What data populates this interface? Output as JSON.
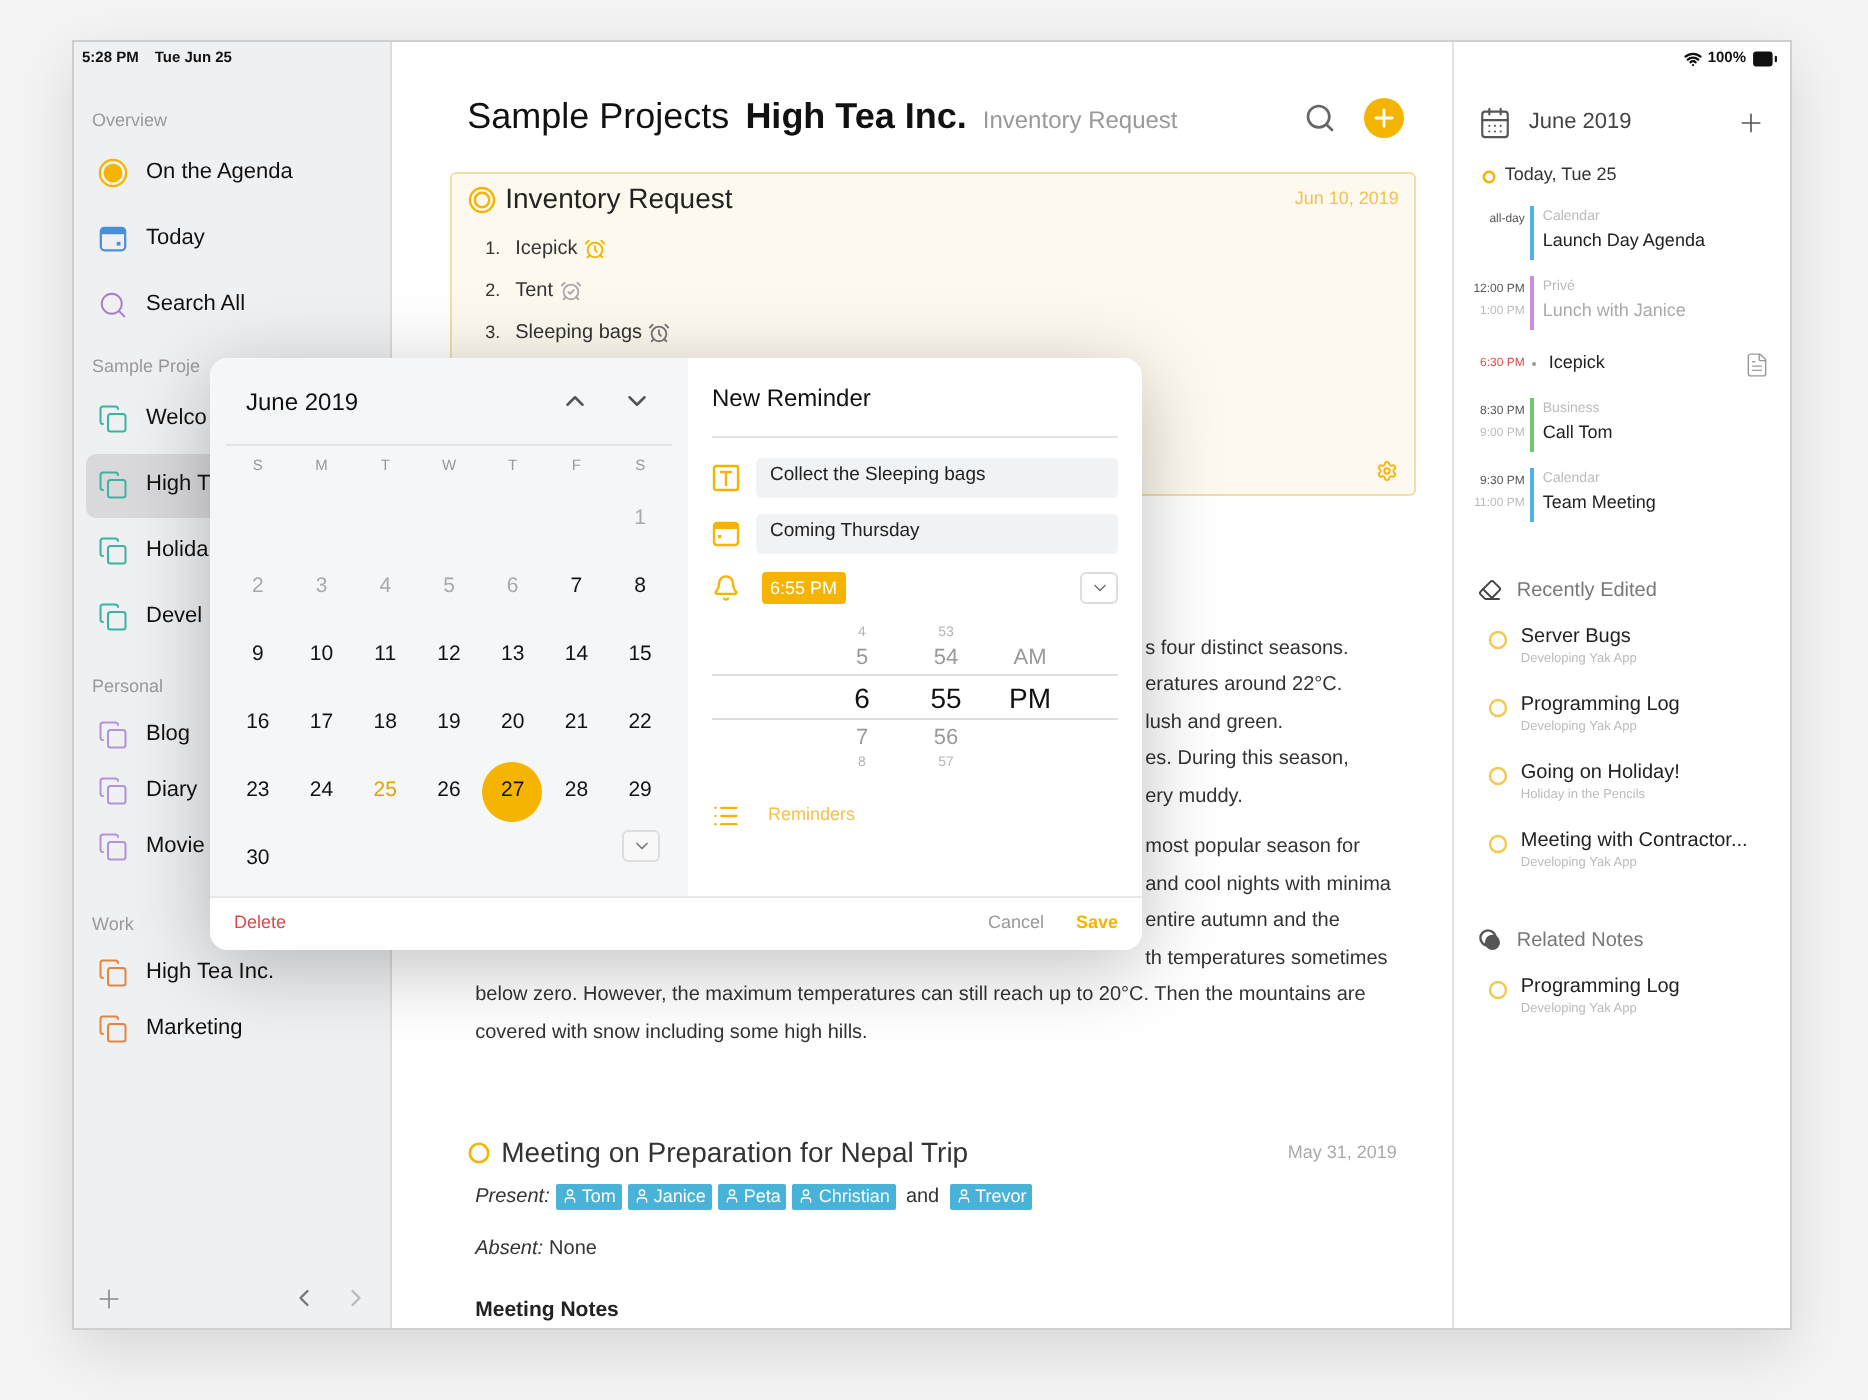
{
  "status_bar": {
    "time": "5:28 PM",
    "date": "Tue Jun 25",
    "battery": "100%"
  },
  "sidebar": {
    "sections": [
      {
        "title": "Overview",
        "items": [
          {
            "label": "On the Agenda",
            "color": "#f5b400",
            "selected": false
          },
          {
            "label": "Today",
            "color": "#4a90d9",
            "selected": false
          },
          {
            "label": "Search All",
            "color": "#a77bd0",
            "selected": false
          }
        ]
      },
      {
        "title": "Sample Proje",
        "items": [
          {
            "label": "Welco",
            "color": "#3bb3a0",
            "selected": false
          },
          {
            "label": "High T",
            "color": "#3bb3a0",
            "selected": true
          },
          {
            "label": "Holida",
            "color": "#3bb3a0",
            "selected": false
          },
          {
            "label": "Devel",
            "color": "#3bb3a0",
            "selected": false
          }
        ]
      },
      {
        "title": "Personal",
        "items": [
          {
            "label": "Blog",
            "color": "#b294d6",
            "selected": false
          },
          {
            "label": "Diary",
            "color": "#b294d6",
            "selected": false
          },
          {
            "label": "Movie",
            "color": "#b294d6",
            "selected": false
          }
        ]
      },
      {
        "title": "Work",
        "items": [
          {
            "label": "High Tea Inc.",
            "color": "#e8843a",
            "selected": false
          },
          {
            "label": "Marketing",
            "color": "#e8843a",
            "selected": false
          }
        ]
      }
    ]
  },
  "header": {
    "path": "Sample Projects",
    "project": "High Tea Inc.",
    "note": "Inventory Request"
  },
  "note_card": {
    "title": "Inventory Request",
    "date": "Jun 10, 2019",
    "items": [
      {
        "number": "1.",
        "label": "Icepick",
        "kind": "active"
      },
      {
        "number": "2.",
        "label": "Tent",
        "kind": "done"
      },
      {
        "number": "3.",
        "label": "Sleeping bags",
        "kind": "set"
      }
    ]
  },
  "body": {
    "paragraphs": [
      {
        "lines": [
          {
            "kind": "fragment",
            "text": "s four distinct seasons."
          },
          {
            "kind": "fragment",
            "text": "eratures around 22°C."
          },
          {
            "kind": "fragment",
            "text": "lush and green."
          },
          {
            "kind": "fragment",
            "text": "es. During this season,"
          },
          {
            "kind": "fragment",
            "text": "ery muddy."
          }
        ]
      },
      {
        "lines": [
          {
            "kind": "fragment",
            "text": "most popular season for"
          },
          {
            "kind": "fragment",
            "text": "and cool nights with minima"
          },
          {
            "kind": "fragment",
            "text": "entire autumn and the"
          },
          {
            "kind": "fragment",
            "text": "th temperatures sometimes"
          },
          {
            "kind": "line",
            "text": "below zero. However, the maximum temperatures can still reach up to 20°C. Then the mountains are"
          },
          {
            "kind": "line",
            "text": "covered with snow including some high hills."
          }
        ]
      }
    ]
  },
  "meeting": {
    "title": "Meeting on Preparation for Nepal Trip",
    "date": "May 31, 2019",
    "present_label": "Present:",
    "present": [
      "Tom",
      "Janice",
      "Peta",
      "Christian",
      "Trevor"
    ],
    "conjunction": "and",
    "absent_label": "Absent:",
    "absent": "None",
    "notes_heading": "Meeting Notes"
  },
  "popup": {
    "calendar": {
      "month": "June 2019",
      "weekdays": [
        "S",
        "M",
        "T",
        "W",
        "T",
        "F",
        "S"
      ],
      "weeks": [
        {
          "days": [
            {
              "label": "1",
              "disabled": true,
              "today": false,
              "selected": false
            }
          ]
        },
        {
          "days": [
            {
              "label": "2",
              "disabled": true,
              "today": false,
              "selected": false
            },
            {
              "label": "3",
              "disabled": true,
              "today": false,
              "selected": false
            },
            {
              "label": "4",
              "disabled": true,
              "today": false,
              "selected": false
            },
            {
              "label": "5",
              "disabled": true,
              "today": false,
              "selected": false
            },
            {
              "label": "6",
              "disabled": true,
              "today": false,
              "selected": false
            },
            {
              "label": "7",
              "disabled": false,
              "today": false,
              "selected": false
            },
            {
              "label": "8",
              "disabled": false,
              "today": false,
              "selected": false
            }
          ]
        },
        {
          "days": [
            {
              "label": "9",
              "disabled": false,
              "today": false,
              "selected": false
            },
            {
              "label": "10",
              "disabled": false,
              "today": false,
              "selected": false
            },
            {
              "label": "11",
              "disabled": false,
              "today": false,
              "selected": false
            },
            {
              "label": "12",
              "disabled": false,
              "today": false,
              "selected": false
            },
            {
              "label": "13",
              "disabled": false,
              "today": false,
              "selected": false
            },
            {
              "label": "14",
              "disabled": false,
              "today": false,
              "selected": false
            },
            {
              "label": "15",
              "disabled": false,
              "today": false,
              "selected": false
            }
          ]
        },
        {
          "days": [
            {
              "label": "16",
              "disabled": false,
              "today": false,
              "selected": false
            },
            {
              "label": "17",
              "disabled": false,
              "today": false,
              "selected": false
            },
            {
              "label": "18",
              "disabled": false,
              "today": false,
              "selected": false
            },
            {
              "label": "19",
              "disabled": false,
              "today": false,
              "selected": false
            },
            {
              "label": "20",
              "disabled": false,
              "today": false,
              "selected": false
            },
            {
              "label": "21",
              "disabled": false,
              "today": false,
              "selected": false
            },
            {
              "label": "22",
              "disabled": false,
              "today": false,
              "selected": false
            }
          ]
        },
        {
          "days": [
            {
              "label": "23",
              "disabled": false,
              "today": false,
              "selected": false
            },
            {
              "label": "24",
              "disabled": false,
              "today": false,
              "selected": false
            },
            {
              "label": "25",
              "disabled": false,
              "today": true,
              "selected": false
            },
            {
              "label": "26",
              "disabled": false,
              "today": false,
              "selected": false
            },
            {
              "label": "27",
              "disabled": false,
              "today": false,
              "selected": true
            },
            {
              "label": "28",
              "disabled": false,
              "today": false,
              "selected": false
            },
            {
              "label": "29",
              "disabled": false,
              "today": false,
              "selected": false
            }
          ]
        },
        {
          "days": [
            {
              "label": "30",
              "disabled": false,
              "today": false,
              "selected": false
            }
          ]
        }
      ]
    },
    "reminder": {
      "title": "New Reminder",
      "text": "Collect the Sleeping bags",
      "date": "Coming Thursday",
      "time": "6:55 PM",
      "picker": [
        {
          "items": [
            {
              "label": "4",
              "selected": false
            },
            {
              "label": "5",
              "selected": false
            },
            {
              "label": "6",
              "selected": true
            },
            {
              "label": "7",
              "selected": false
            },
            {
              "label": "8",
              "selected": false
            }
          ]
        },
        {
          "items": [
            {
              "label": "53",
              "selected": false
            },
            {
              "label": "54",
              "selected": false
            },
            {
              "label": "55",
              "selected": true
            },
            {
              "label": "56",
              "selected": false
            },
            {
              "label": "57",
              "selected": false
            }
          ]
        },
        {
          "items": [
            {
              "label": "AM",
              "selected": false
            },
            {
              "label": "PM",
              "selected": true
            }
          ]
        }
      ],
      "list": "Reminders"
    },
    "actions": {
      "delete": "Delete",
      "cancel": "Cancel",
      "save": "Save"
    }
  },
  "agenda": {
    "title": "June 2019",
    "day": "Today, Tue 25",
    "events": [
      {
        "kind": "event",
        "start": "all-day",
        "calendar": "Calendar",
        "title": "Launch Day Agenda",
        "color": "#4fb3e8",
        "past": false
      },
      {
        "kind": "event",
        "start": "12:00 PM",
        "end": "1:00 PM",
        "calendar": "Privé",
        "title": "Lunch with Janice",
        "color": "#c88fdf",
        "past": true
      },
      {
        "kind": "reminder",
        "start": "6:30 PM",
        "title": "Icepick",
        "overdue": true
      },
      {
        "kind": "event",
        "start": "8:30 PM",
        "end": "9:00 PM",
        "calendar": "Business",
        "title": "Call Tom",
        "color": "#6cc970",
        "past": false
      },
      {
        "kind": "event",
        "start": "9:30 PM",
        "end": "11:00 PM",
        "calendar": "Calendar",
        "title": "Team Meeting",
        "color": "#4fb3e8",
        "past": false
      }
    ]
  },
  "recent": {
    "title": "Recently Edited",
    "items": [
      {
        "title": "Server Bugs",
        "subtitle": "Developing Yak App"
      },
      {
        "title": "Programming Log",
        "subtitle": "Developing Yak App"
      },
      {
        "title": "Going on Holiday!",
        "subtitle": "Holiday in the Pencils"
      },
      {
        "title": "Meeting with Contractor...",
        "subtitle": "Developing Yak App"
      }
    ]
  },
  "related": {
    "title": "Related Notes",
    "items": [
      {
        "title": "Programming Log",
        "subtitle": "Developing Yak App"
      }
    ]
  }
}
